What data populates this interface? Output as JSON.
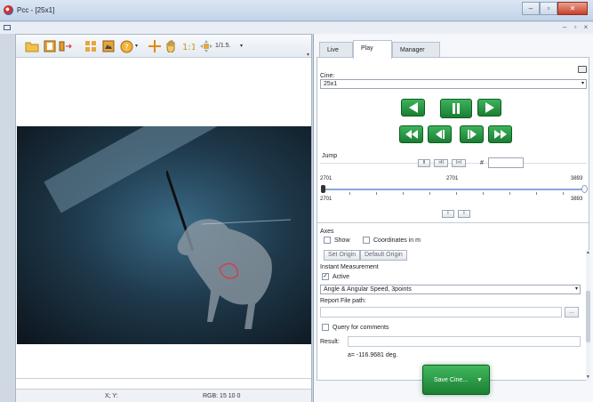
{
  "window": {
    "title": "Pcc - [25x1]",
    "minimize": "–",
    "maximize": "▫",
    "close": "✕"
  },
  "mdi": {
    "minimize": "–",
    "restore": "▫",
    "close": "×"
  },
  "toolbar": {
    "zoom_label": "1/1.5.",
    "caret": "▾",
    "overflow": "▾"
  },
  "status": {
    "coords": "X; Y:",
    "rgb": "RGB: 15 10 0"
  },
  "tabs": [
    "Live",
    "Play",
    "Manager"
  ],
  "play": {
    "cine_label": "Cine:",
    "cine_value": "25x1",
    "jump_label": "Jump",
    "jump_buttons": [
      "II",
      ">II",
      "I>I"
    ],
    "jump_hash": "#",
    "range_start": "2701",
    "range_mid": "2701",
    "range_end": "3893",
    "range_start_2": "2701",
    "range_end_2": "3893",
    "marker_buttons": [
      "I",
      "I"
    ]
  },
  "measure": {
    "axes_label": "Axes",
    "show_label": "Show",
    "coords_label": "Coordinates in m",
    "set_origin": "Set Origin",
    "default_origin": "Default Origin",
    "instant_label": "Instant Measurement",
    "active_label": "Active",
    "active_check": "✓",
    "mode_value": "Angle & Angular Speed, 3points",
    "report_label": "Report File path:",
    "browse": "...",
    "query_label": "Query for comments",
    "result_label": "Result:",
    "result_value": "a= -116.9681 deg."
  },
  "save": {
    "label": "Save Cine...",
    "caret": "▼"
  },
  "scroll": {
    "up": "▲",
    "down": "▼"
  },
  "colors": {
    "accent_green": "#2a9a47",
    "panel_bg": "#ffffff",
    "titlebar": "#c2d3e8"
  }
}
